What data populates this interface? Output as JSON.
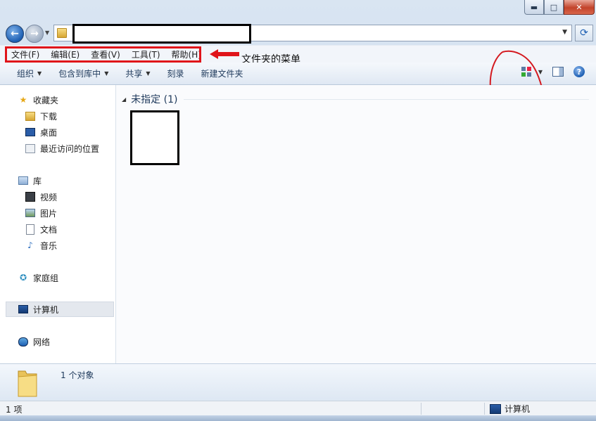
{
  "window": {
    "controls": {
      "minimize": "▬",
      "maximize": "□",
      "close": "✕"
    }
  },
  "address": {
    "back_icon": "←",
    "forward_icon": "→",
    "refresh_icon": "⟳"
  },
  "menu": {
    "items": [
      "文件(F)",
      "编辑(E)",
      "查看(V)",
      "工具(T)",
      "帮助(H)"
    ],
    "annotation": "文件夹的菜单"
  },
  "toolbar": {
    "organize": "组织",
    "include_in_library": "包含到库中",
    "share": "共享",
    "burn": "刻录",
    "new_folder": "新建文件夹",
    "help_icon_text": "?"
  },
  "nav": {
    "favorites": "收藏夹",
    "downloads": "下载",
    "desktop": "桌面",
    "recent": "最近访问的位置",
    "libraries": "库",
    "videos": "视频",
    "pictures": "图片",
    "documents": "文档",
    "music": "音乐",
    "homegroup": "家庭组",
    "computer": "计算机",
    "network": "网络"
  },
  "content": {
    "group_header": "未指定 (1)"
  },
  "details": {
    "count_text": "1 个对象"
  },
  "status": {
    "left": "1 项",
    "right": "计算机"
  },
  "colors": {
    "annotation_red": "#e0141a",
    "accent_blue": "#1e395b"
  }
}
